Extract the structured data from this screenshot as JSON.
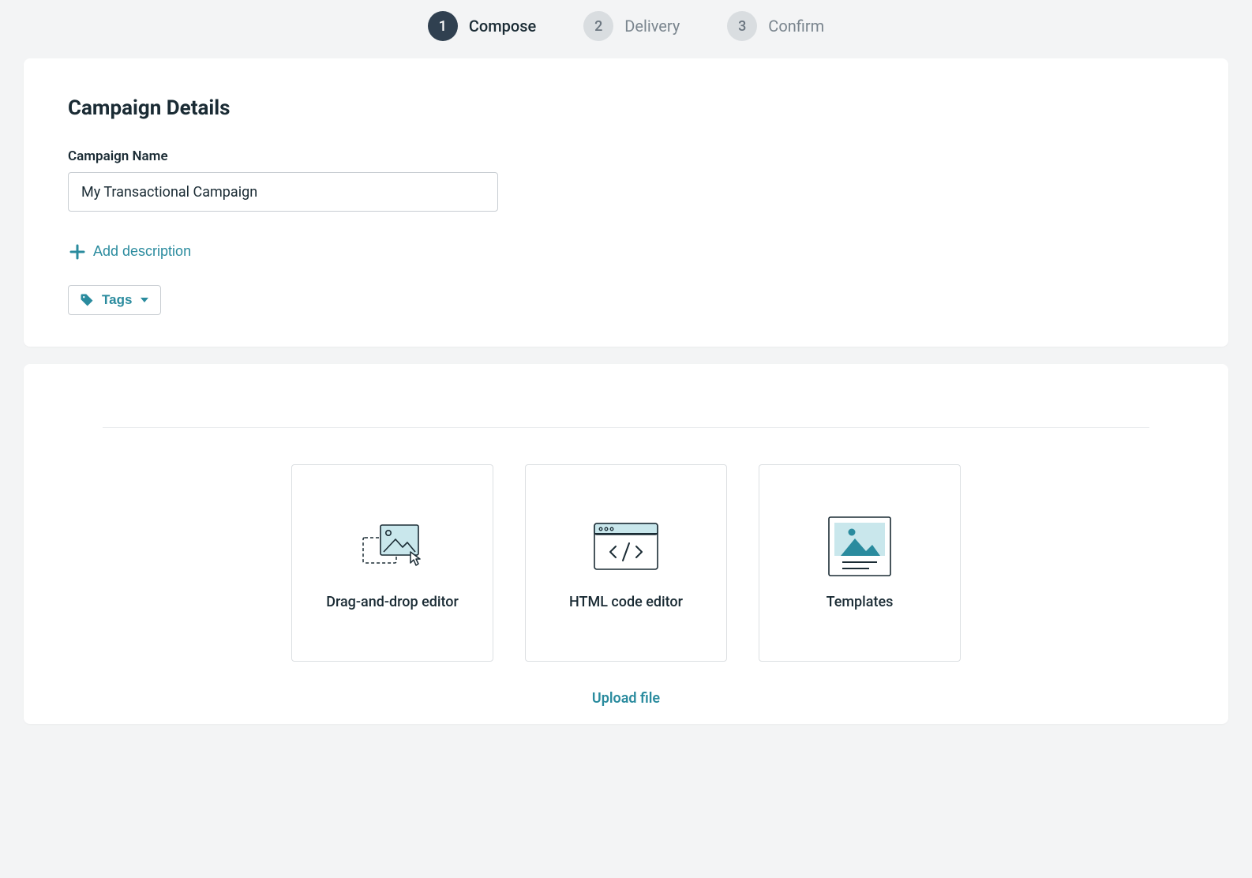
{
  "stepper": {
    "steps": [
      {
        "num": "1",
        "label": "Compose",
        "active": true
      },
      {
        "num": "2",
        "label": "Delivery",
        "active": false
      },
      {
        "num": "3",
        "label": "Confirm",
        "active": false
      }
    ]
  },
  "details": {
    "title": "Campaign Details",
    "name_label": "Campaign Name",
    "name_value": "My Transactional Campaign",
    "add_description": "Add description",
    "tags_label": "Tags"
  },
  "editors": {
    "options": [
      {
        "label": "Drag-and-drop editor"
      },
      {
        "label": "HTML code editor"
      },
      {
        "label": "Templates"
      }
    ],
    "upload": "Upload file"
  },
  "colors": {
    "accent": "#2a8b9e",
    "light_fill": "#c9e7ec"
  }
}
